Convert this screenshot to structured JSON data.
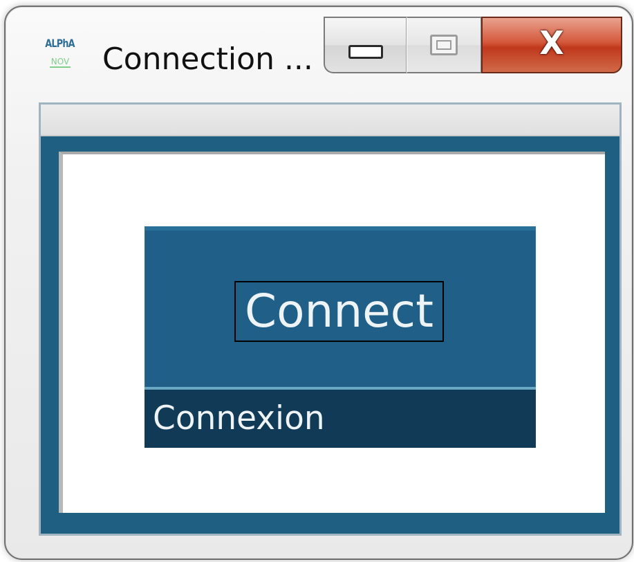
{
  "window": {
    "title": "Connection ...",
    "icon": {
      "name": "alphanov-logo-icon",
      "line1": "ALPhA",
      "line2": "NOV"
    },
    "caption_buttons": {
      "minimize": "minimize-icon",
      "maximize": "maximize-icon",
      "close_label": "X"
    }
  },
  "tile": {
    "label": "Connect",
    "caption": "Connexion"
  },
  "colors": {
    "tile_background": "#1f5f88",
    "tile_footer": "#103a55",
    "client_frame": "#1f5f82",
    "close_button": "#c0381c"
  }
}
